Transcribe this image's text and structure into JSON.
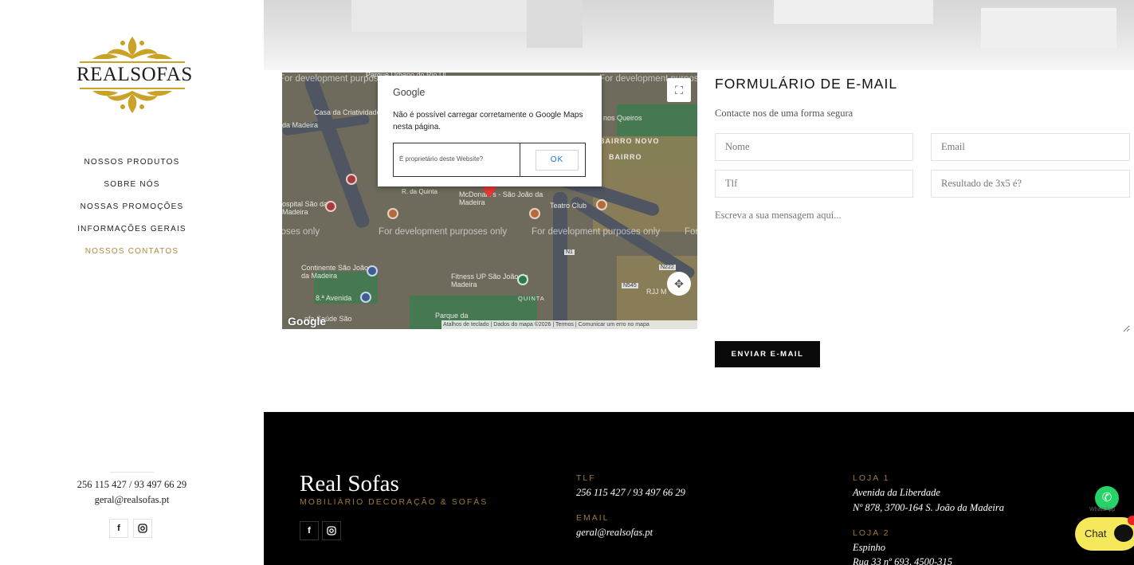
{
  "brand": {
    "logo_text": "REALSOFAS"
  },
  "nav": {
    "items": [
      {
        "label": "NOSSOS PRODUTOS"
      },
      {
        "label": "SOBRE NÓS"
      },
      {
        "label": "NOSSAS PROMOÇÕES"
      },
      {
        "label": "INFORMAÇÕES GERAIS"
      },
      {
        "label": "NOSSOS CONTATOS"
      }
    ],
    "active_index": 4,
    "active_color": "#b08a3e"
  },
  "sidebar_contact": {
    "phone": "256 115 427 / 93 497 66 29",
    "email": "geral@realsofas.pt",
    "facebook_icon": "facebook-icon",
    "instagram_icon": "instagram-icon"
  },
  "map": {
    "labels": [
      "Parque Urbano do Rio Ul",
      "Casa da Criatividade",
      "da Madeira",
      "nos Queiros",
      "BAIRRO NOVO",
      "BAIRRO",
      "R. da Quinta",
      "McDonald's - São João da Madeira",
      "Teatro Club",
      "ospital São da Madeira",
      "Continente São João da Madeira",
      "8.ª Avenida",
      "Fitness UP São João da Madeira",
      "QUINTA",
      "Parque da",
      "ofa Saúde São",
      "N1",
      "N222",
      "N545",
      "RJJ M"
    ],
    "dev_watermark": "For development purposes only",
    "google_logo": "Google",
    "attribution": "Atalhos de teclado | Dados do mapa ©2026 | Termos | Comunicar um erro no mapa"
  },
  "map_dialog": {
    "title": "Google",
    "message": "Não é possível carregar corretamente o Google Maps nesta página.",
    "question": "É proprietário deste Website?",
    "ok_label": "OK"
  },
  "form": {
    "title": "FORMULÁRIO DE E-MAIL",
    "subtitle": "Contacte nos de uma forma segura",
    "name_placeholder": "Nome",
    "email_placeholder": "Email",
    "phone_placeholder": "Tlf",
    "captcha_placeholder": "Resultado de 3x5 é?",
    "message_placeholder": "Escreva a sua mensagem aqui...",
    "submit_label": "ENVIAR E-MAIL"
  },
  "footer": {
    "brand": "Real Sofas",
    "tagline": "MOBILIÁRIO DECORAÇÃO & SOFÁS",
    "tlf_label": "TLF",
    "tlf_value": "256 115 427 / 93 497 66 29",
    "email_label": "EMAIL",
    "email_value": "geral@realsofas.pt",
    "store1_label": "LOJA 1",
    "store1_line1": "Avenida da Liberdade",
    "store1_line2": "Nº 878, 3700-164 S. João da Madeira",
    "store2_label": "LOJA 2",
    "store2_line1": "Espinho",
    "store2_line2": "Rua 33 nº 693, 4500-315",
    "accent_color": "#9c7a3b"
  },
  "widgets": {
    "whatsapp_label": "WhatsApp",
    "chat_label": "Chat",
    "chat_color": "#f5e85a"
  }
}
